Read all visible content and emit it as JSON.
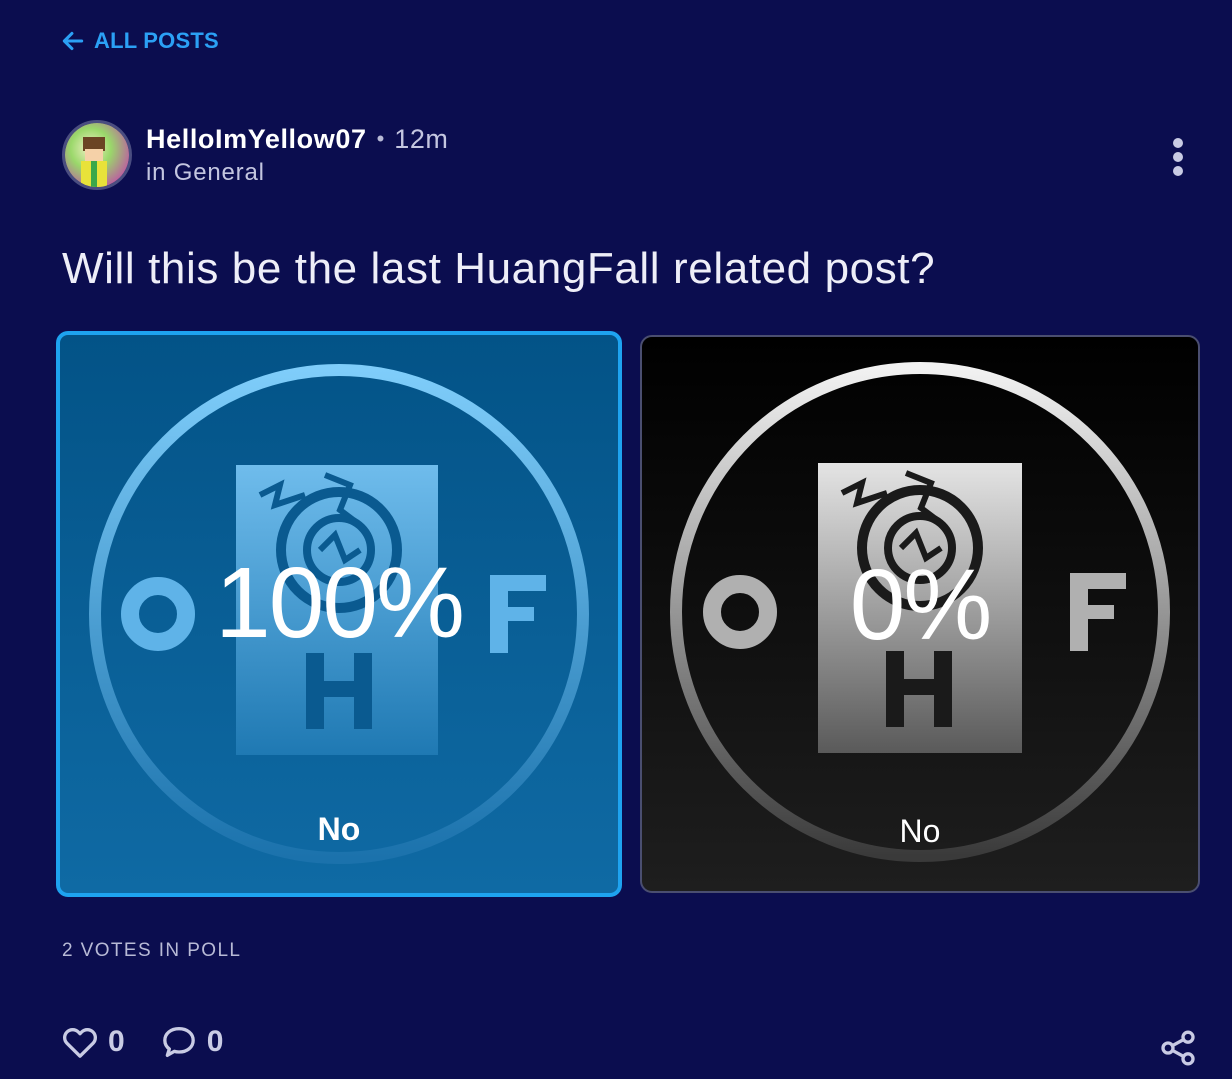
{
  "nav": {
    "back_label": "ALL POSTS"
  },
  "post": {
    "author": "HelloImYellow07",
    "separator": "•",
    "time_ago": "12m",
    "community_prefix": "in",
    "community": "General",
    "title": "Will this be the last HuangFall related post?"
  },
  "poll": {
    "options": [
      {
        "percent": "100%",
        "label": "No",
        "selected": true
      },
      {
        "percent": "0%",
        "label": "No",
        "selected": false
      }
    ],
    "votes_text": "2 VOTES IN POLL"
  },
  "actions": {
    "likes": "0",
    "comments": "0"
  },
  "icons": {
    "back": "arrow-left-icon",
    "more": "more-vertical-icon",
    "like": "heart-icon",
    "comment": "comment-icon",
    "share": "share-icon"
  },
  "colors": {
    "background": "#0b0d4f",
    "accent": "#1ea3f0",
    "link": "#2ba0f5"
  }
}
